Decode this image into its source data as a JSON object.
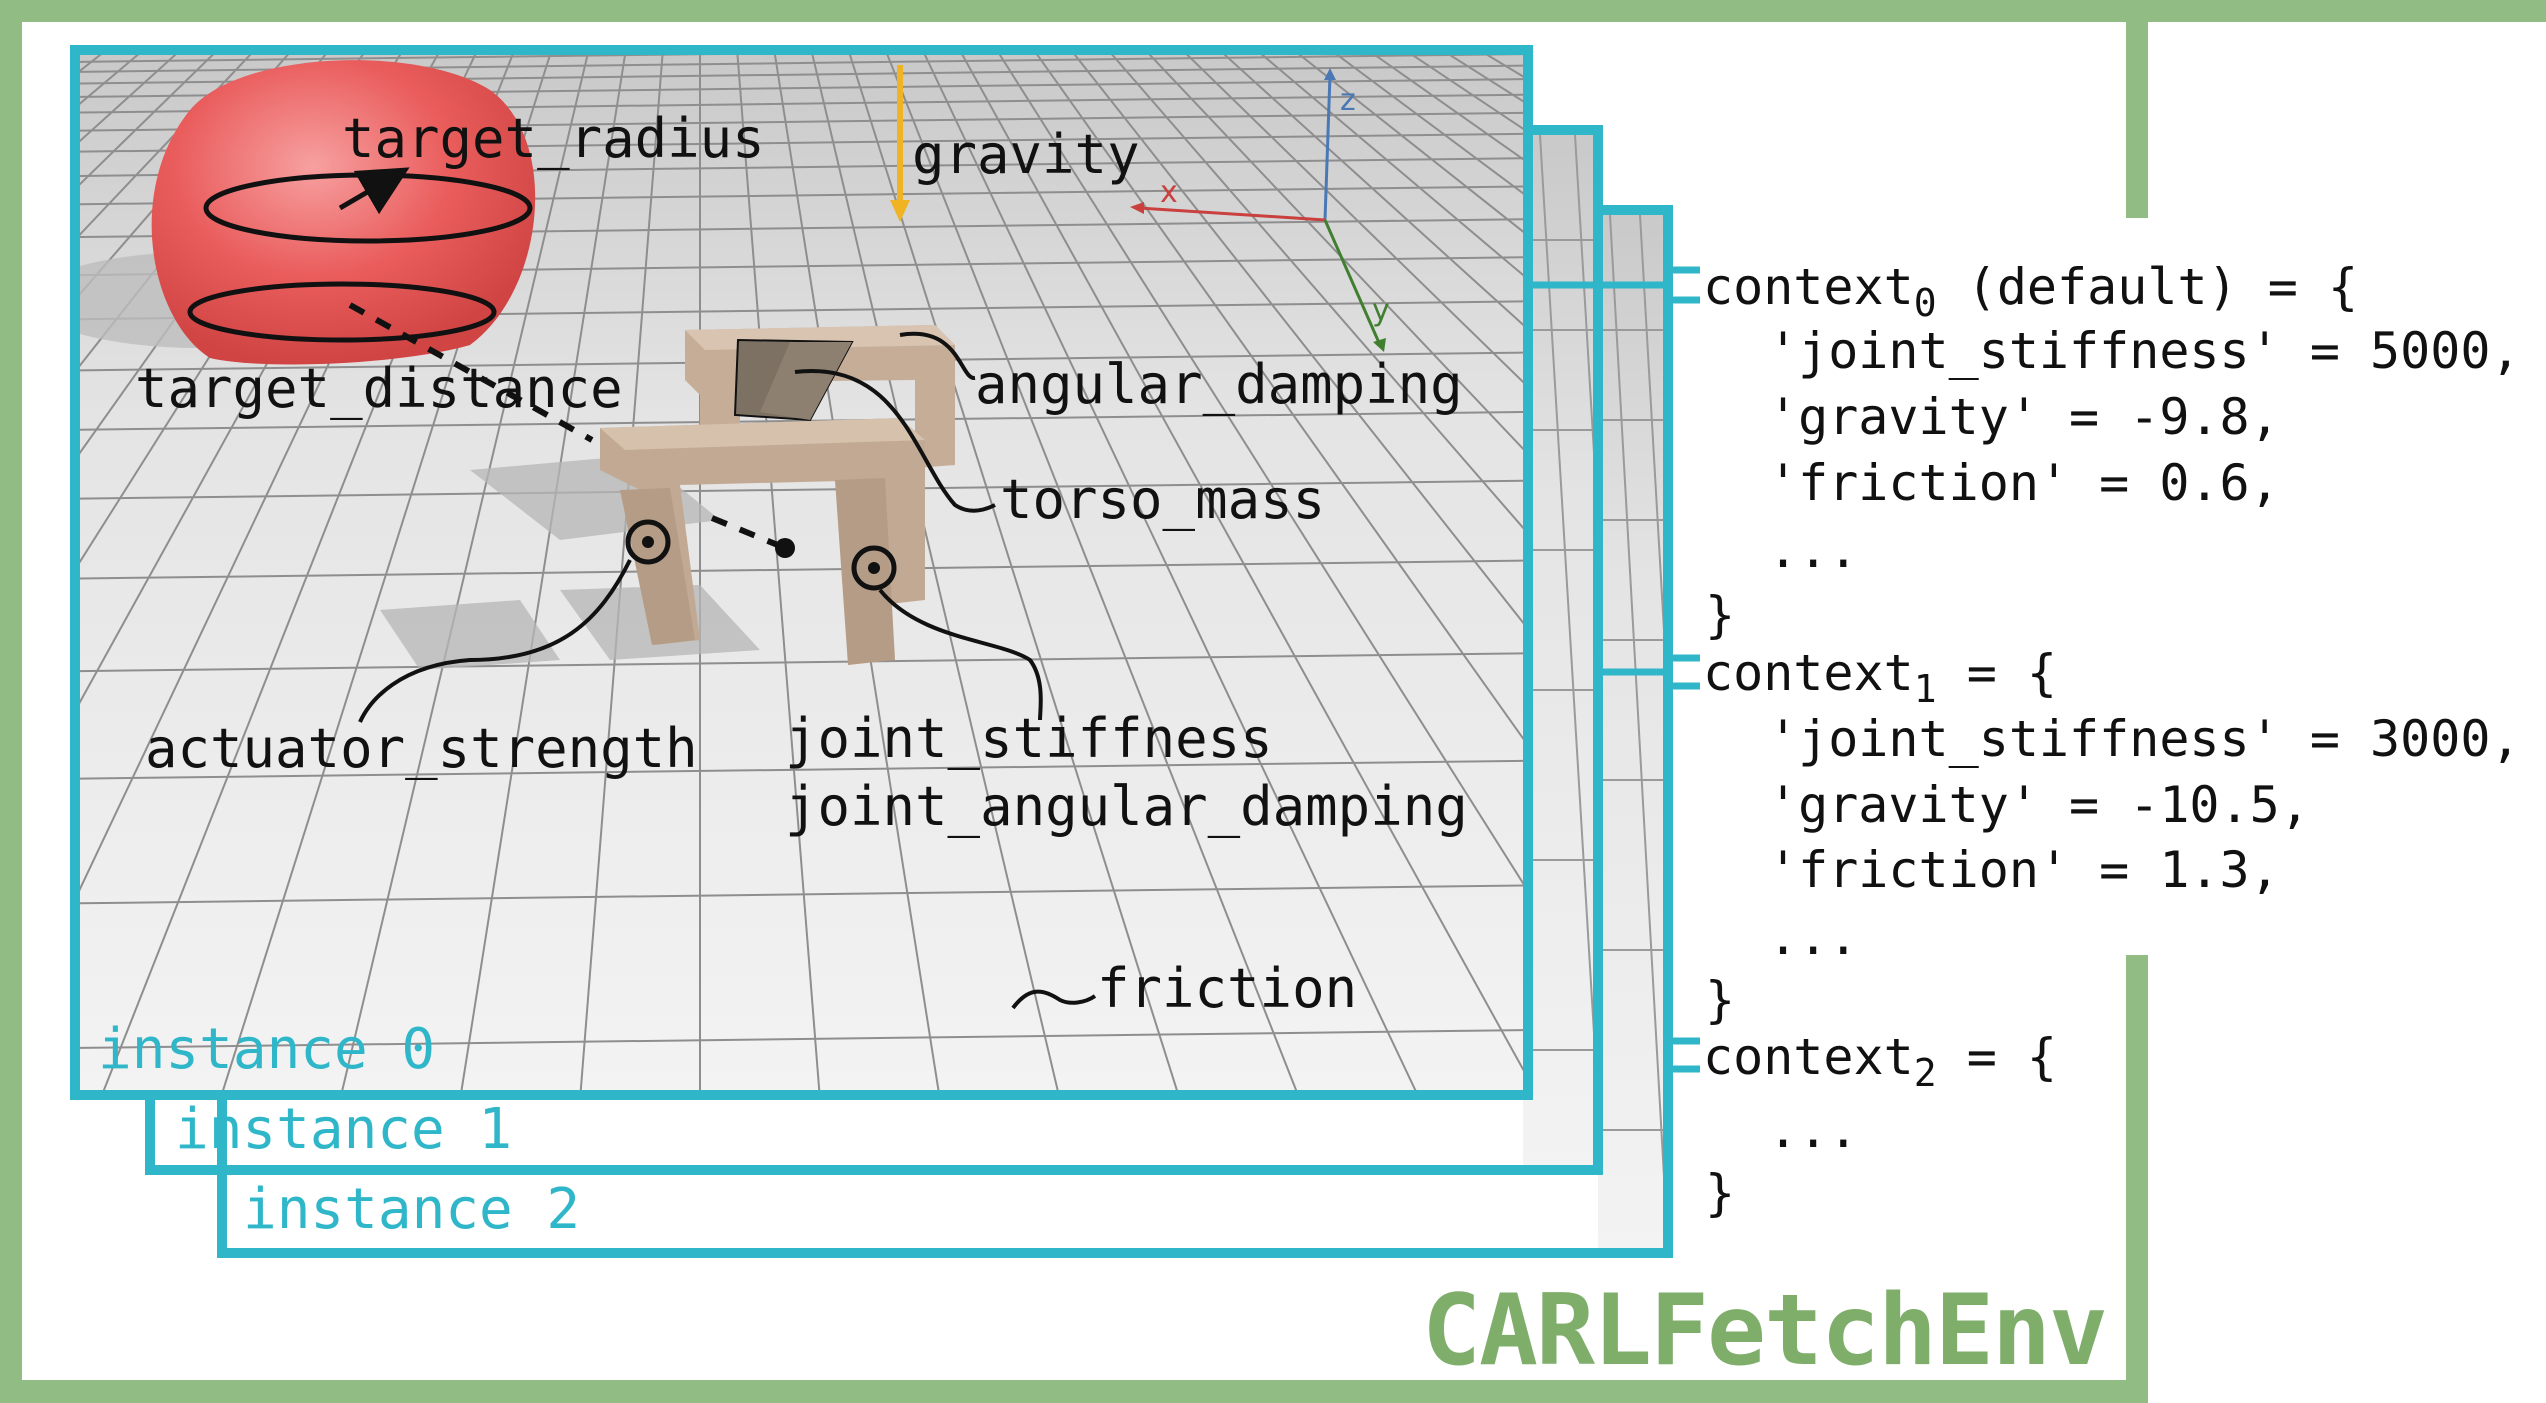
{
  "environment": {
    "name": "CARLFetchEnv",
    "frame_color": "#91bc83",
    "instance_color": "#2fb7c9"
  },
  "instances": [
    {
      "label": "instance 0"
    },
    {
      "label": "instance 1"
    },
    {
      "label": "instance 2"
    }
  ],
  "scene_labels": {
    "target_radius": "target_radius",
    "gravity": "gravity",
    "target_distance": "target_distance",
    "angular_damping": "angular_damping",
    "torso_mass": "torso_mass",
    "actuator_strength": "actuator_strength",
    "joint_stiffness": "joint_stiffness",
    "joint_angular_damping": "joint_angular_damping",
    "friction": "friction"
  },
  "axes": {
    "x": "x",
    "y": "y",
    "z": "z"
  },
  "contexts": [
    {
      "name": "context",
      "index": "0",
      "suffix": " (default) = {",
      "entries": [
        "'joint_stiffness' = 5000,",
        "'gravity' = -9.8,",
        "'friction' = 0.6,",
        "..."
      ],
      "close": "}"
    },
    {
      "name": "context",
      "index": "1",
      "suffix": " = {",
      "entries": [
        "'joint_stiffness' = 3000,",
        "'gravity' = -10.5,",
        "'friction' = 1.3,",
        "..."
      ],
      "close": "}"
    },
    {
      "name": "context",
      "index": "2",
      "suffix": " = {",
      "entries": [
        "..."
      ],
      "close": "}"
    }
  ]
}
